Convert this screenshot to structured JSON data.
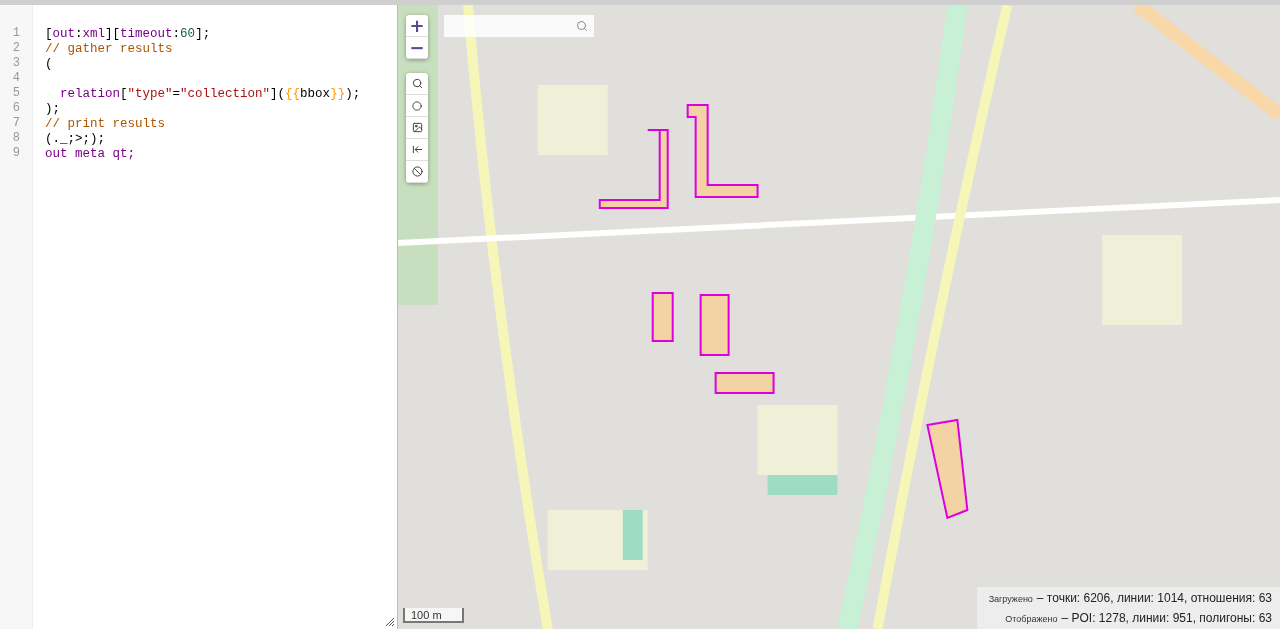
{
  "editor": {
    "lines": [
      {
        "number": "1",
        "tokens": [
          {
            "text": "[",
            "kind": "plain"
          },
          {
            "text": "out",
            "kind": "keyword"
          },
          {
            "text": ":",
            "kind": "plain"
          },
          {
            "text": "xml",
            "kind": "keyword"
          },
          {
            "text": "][",
            "kind": "plain"
          },
          {
            "text": "timeout",
            "kind": "keyword"
          },
          {
            "text": ":",
            "kind": "plain"
          },
          {
            "text": "60",
            "kind": "number"
          },
          {
            "text": "];",
            "kind": "plain"
          }
        ]
      },
      {
        "number": "2",
        "tokens": [
          {
            "text": "// gather results",
            "kind": "comment"
          }
        ]
      },
      {
        "number": "3",
        "tokens": [
          {
            "text": "(",
            "kind": "plain"
          }
        ]
      },
      {
        "number": "4"
      },
      {
        "number": "5",
        "tokens": [
          {
            "text": "  relation",
            "kind": "keyword"
          },
          {
            "text": "[",
            "kind": "plain"
          },
          {
            "text": "\"type\"",
            "kind": "string"
          },
          {
            "text": "=",
            "kind": "plain"
          },
          {
            "text": "\"collection\"",
            "kind": "string"
          },
          {
            "text": "](",
            "kind": "plain"
          },
          {
            "text": "{{",
            "kind": "template"
          },
          {
            "text": "bbox",
            "kind": "plain"
          },
          {
            "text": "}}",
            "kind": "template"
          },
          {
            "text": ");",
            "kind": "plain"
          }
        ]
      },
      {
        "number": "6",
        "tokens": [
          {
            "text": ");",
            "kind": "plain"
          }
        ]
      },
      {
        "number": "7",
        "tokens": [
          {
            "text": "// print results",
            "kind": "comment"
          }
        ]
      },
      {
        "number": "8",
        "tokens": [
          {
            "text": "(._;>;);",
            "kind": "plain"
          }
        ]
      },
      {
        "number": "9",
        "tokens": [
          {
            "text": "out meta qt;",
            "kind": "keyword"
          }
        ]
      }
    ]
  },
  "map": {
    "zoom_in": "+",
    "zoom_out": "−",
    "scale": "100 m",
    "stats": [
      {
        "label": "Загружено",
        "value": "– точки: 6206, линии: 1014, отношения: 63"
      },
      {
        "label": "Отображено",
        "value": "– POI: 1278, линии: 951, полигоны: 63"
      }
    ]
  }
}
